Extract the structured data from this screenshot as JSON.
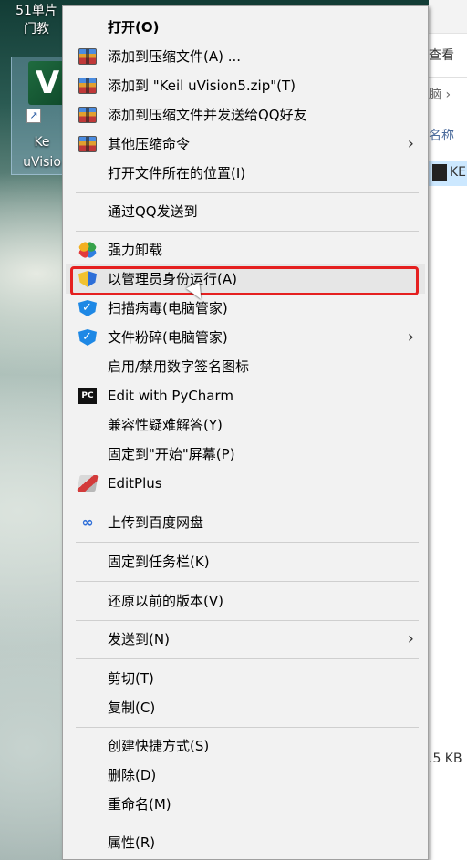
{
  "desktop": {
    "label_line1": "51单片",
    "label_line2": "门教",
    "icon_name_line1": "Ke",
    "icon_name_line2": "uVisio",
    "icon_glyph": "V",
    "shortcut_glyph": "↗"
  },
  "explorer": {
    "view_text": "查看",
    "path_text": "脑 ›",
    "column_name": "名称",
    "file_label": "KE",
    "size_text": ".5 KB"
  },
  "menu": {
    "items": [
      {
        "label": "打开(O)",
        "icon": "none"
      },
      {
        "label": "添加到压缩文件(A) ...",
        "icon": "winrar-icon"
      },
      {
        "label": "添加到 \"Keil uVision5.zip\"(T)",
        "icon": "winrar-icon"
      },
      {
        "label": "添加到压缩文件并发送给QQ好友",
        "icon": "winrar-icon"
      },
      {
        "label": "其他压缩命令",
        "icon": "winrar-icon",
        "submenu": "›"
      },
      {
        "label": "打开文件所在的位置(I)",
        "icon": "none"
      },
      {
        "label": "通过QQ发送到",
        "icon": "none"
      },
      {
        "label": "强力卸载",
        "icon": "uninstall-icon"
      },
      {
        "label": "以管理员身份运行(A)",
        "icon": "uac-shield-icon"
      },
      {
        "label": "扫描病毒(电脑管家)",
        "icon": "tencent-shield-icon"
      },
      {
        "label": "文件粉碎(电脑管家)",
        "icon": "tencent-shield-icon",
        "submenu": "›"
      },
      {
        "label": "启用/禁用数字签名图标",
        "icon": "none"
      },
      {
        "label": "Edit with PyCharm",
        "icon": "pycharm-icon"
      },
      {
        "label": "兼容性疑难解答(Y)",
        "icon": "none"
      },
      {
        "label": "固定到\"开始\"屏幕(P)",
        "icon": "none"
      },
      {
        "label": "EditPlus",
        "icon": "editplus-icon"
      },
      {
        "label": "上传到百度网盘",
        "icon": "baidu-netdisk-icon"
      },
      {
        "label": "固定到任务栏(K)",
        "icon": "none"
      },
      {
        "label": "还原以前的版本(V)",
        "icon": "none"
      },
      {
        "label": "发送到(N)",
        "icon": "none",
        "submenu": "›"
      },
      {
        "label": "剪切(T)",
        "icon": "none"
      },
      {
        "label": "复制(C)",
        "icon": "none"
      },
      {
        "label": "创建快捷方式(S)",
        "icon": "none"
      },
      {
        "label": "删除(D)",
        "icon": "none"
      },
      {
        "label": "重命名(M)",
        "icon": "none"
      },
      {
        "label": "属性(R)",
        "icon": "none"
      }
    ],
    "highlighted_item": "以管理员身份运行(A)",
    "highlight_color": "#e52020"
  },
  "icons": {
    "pycharm_text": "PC",
    "baidu_glyph": "∞"
  }
}
